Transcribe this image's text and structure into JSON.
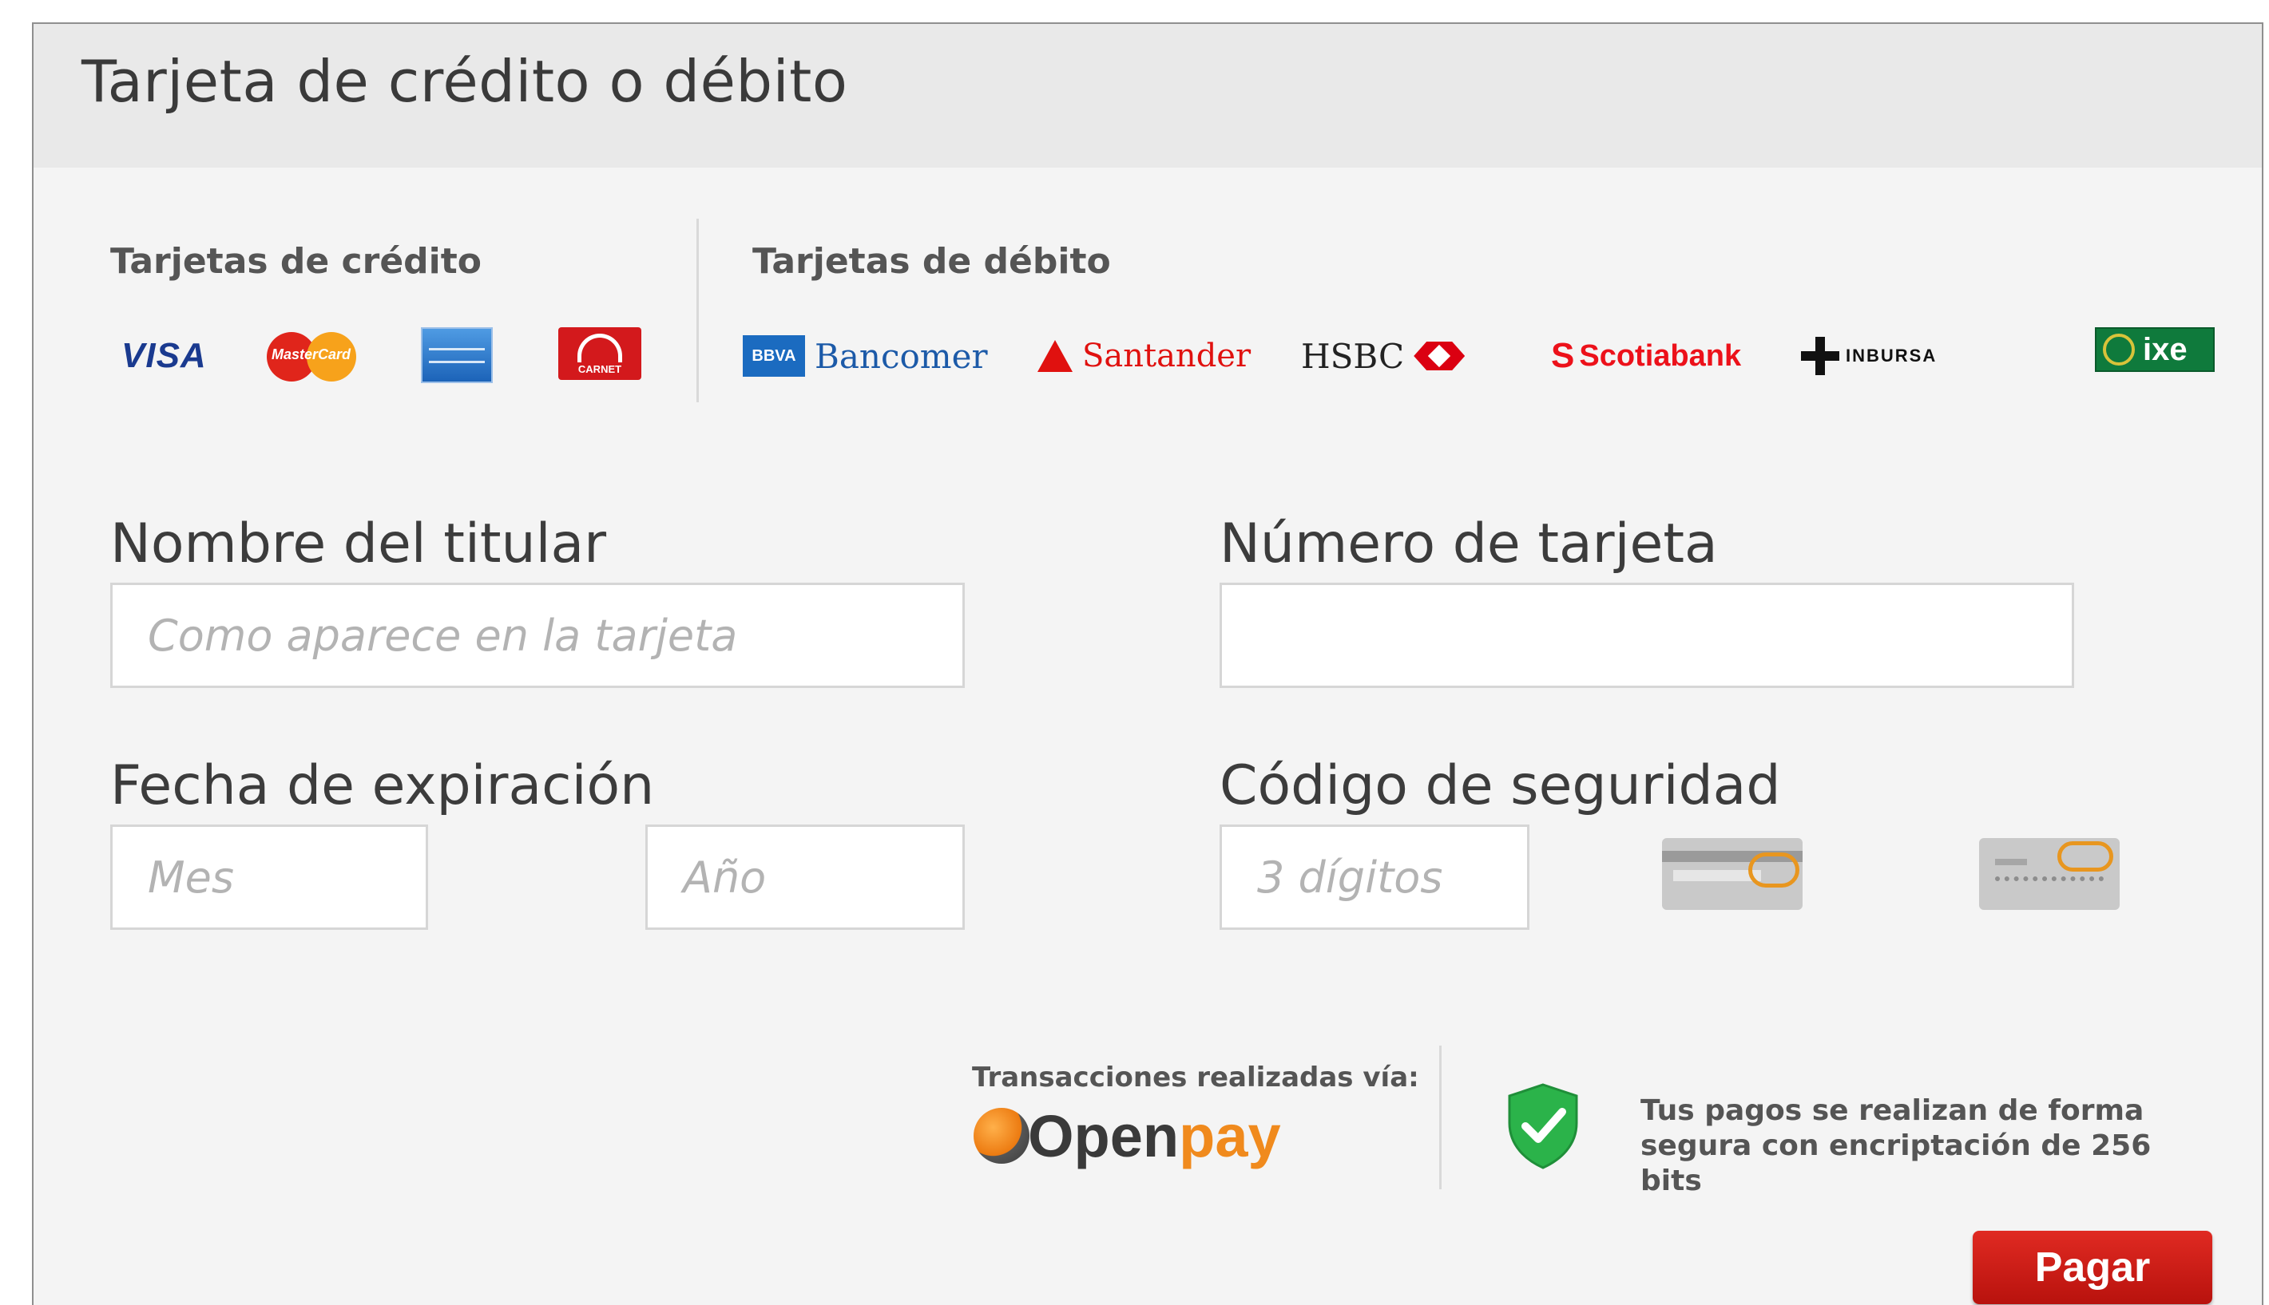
{
  "header": {
    "title": "Tarjeta de crédito o débito"
  },
  "cards": {
    "credit_label": "Tarjetas de crédito",
    "debit_label": "Tarjetas de débito",
    "credit_logos": {
      "visa": "VISA",
      "mastercard": "MasterCard",
      "amex": "American Express",
      "carnet": "CARNET"
    },
    "debit_logos": {
      "bancomer_mark": "BBVA",
      "bancomer": "Bancomer",
      "santander": "Santander",
      "hsbc": "HSBC",
      "scotiabank": "Scotiabank",
      "inbursa": "INBURSA",
      "ixe": "ixe"
    }
  },
  "form": {
    "holder_label": "Nombre del titular",
    "holder_placeholder": "Como aparece en la tarjeta",
    "cardnum_label": "Número de tarjeta",
    "cardnum_placeholder": "",
    "expiry_label": "Fecha de expiración",
    "month_placeholder": "Mes",
    "year_placeholder": "Año",
    "cvv_label": "Código de seguridad",
    "cvv_placeholder": "3 dígitos"
  },
  "footer": {
    "via_label": "Transacciones realizadas vía:",
    "openpay_open": "Open",
    "openpay_pay": "pay",
    "secure_text": "Tus pagos se realizan de forma segura con encriptación de 256 bits",
    "pay_button": "Pagar"
  },
  "colors": {
    "accent": "#d21f17",
    "header_bg": "#e9e9e9",
    "panel_bg": "#f4f4f4",
    "shield": "#2bb34a"
  },
  "icons": {
    "shield": "shield-check-icon",
    "cvv_back": "card-back-cvv-icon",
    "cvv_front": "card-front-cvv-icon"
  }
}
